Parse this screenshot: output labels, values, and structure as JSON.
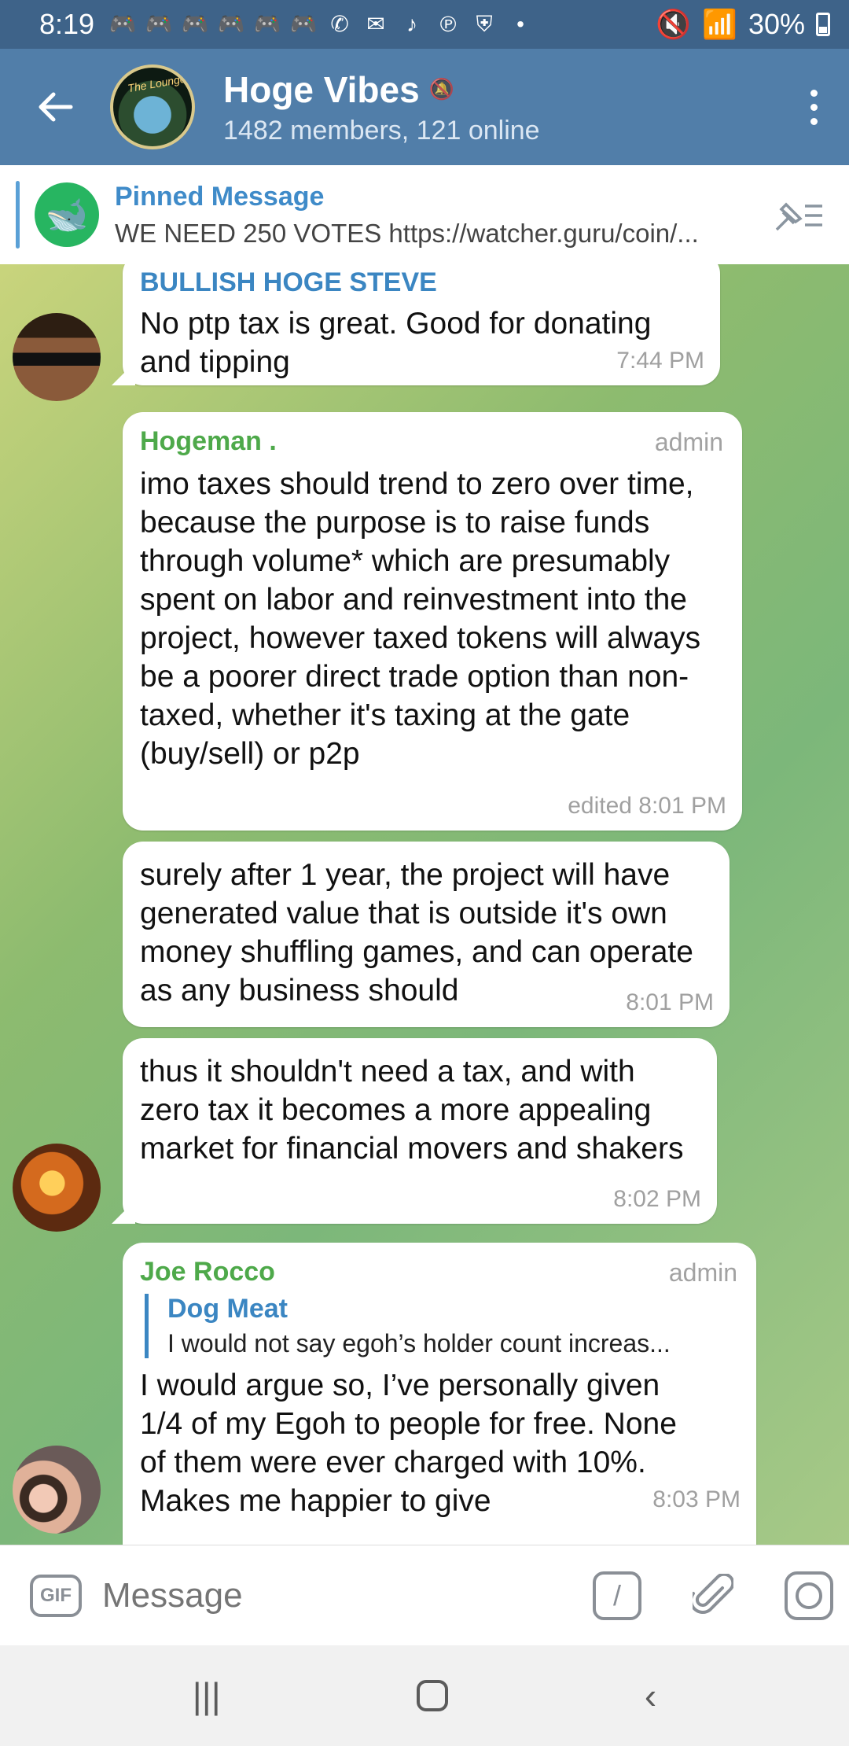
{
  "status_bar": {
    "time": "8:19",
    "battery": "30%"
  },
  "header": {
    "title": "Hoge Vibes",
    "subtitle": "1482 members, 121 online"
  },
  "pinned": {
    "label": "Pinned Message",
    "text": "WE NEED 250 VOTES https://watcher.guru/coin/..."
  },
  "messages": [
    {
      "sender": "BULLISH HOGE STEVE",
      "text": "No ptp tax is great. Good for donating and tipping",
      "time": "7:44 PM"
    },
    {
      "sender": "Hogeman .",
      "role": "admin",
      "text": "imo taxes should trend to zero over time, because the purpose is to raise funds through volume* which are presumably spent on labor and reinvestment into the project, however taxed tokens will always be a poorer direct trade option than non-taxed, whether it's taxing at the gate (buy/sell) or p2p",
      "time": "edited 8:01 PM"
    },
    {
      "text": "surely after 1 year, the project will have generated value that is outside it's own money shuffling games, and can operate as any business should",
      "time": "8:01 PM"
    },
    {
      "text": "thus it shouldn't need a tax, and with zero tax it becomes a more appealing market for financial movers and shakers",
      "time": "8:02 PM"
    },
    {
      "sender": "Joe Rocco",
      "role": "admin",
      "reply_name": "Dog Meat",
      "reply_text": "I would not say egoh’s holder count increas...",
      "text": "I would argue so, I’ve personally given 1/4 of my Egoh to people for free. None of them were ever charged with 10%. Makes me happier to give",
      "time": "8:03 PM"
    }
  ],
  "input": {
    "placeholder": "Message",
    "gif_label": "GIF",
    "command_label": "/"
  },
  "colors": {
    "header": "#517ea9",
    "status_bar": "#3e6389",
    "admin_name": "#4ea94a",
    "link_blue": "#3b86c2"
  }
}
